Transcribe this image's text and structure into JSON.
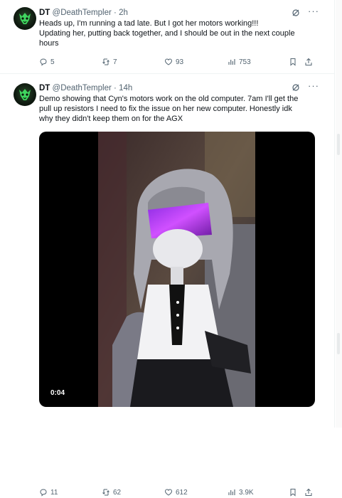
{
  "colors": {
    "accent": "#1d9bf0",
    "text": "#0f1419",
    "muted": "#536471",
    "visor": "#b030ff"
  },
  "tweets": [
    {
      "name": "DT",
      "handle": "@DeathTempler",
      "separator": "·",
      "time": "2h",
      "lines": [
        "Heads up, I'm running a tad late. But I got her motors working!!!",
        "Updating her, putting back together, and I should be out in the next couple",
        "hours"
      ],
      "replies": "5",
      "reposts": "7",
      "likes": "93",
      "views": "753"
    },
    {
      "name": "DT",
      "handle": "@DeathTempler",
      "separator": "·",
      "time": "14h",
      "lines": [
        "Demo showing that Cyn's motors work on the old computer. 7am I'll get the",
        "pull up resistors I need to fix the issue on her new computer. Honestly idk",
        "why they didn't keep them on for the AGX"
      ],
      "video_time": "0:04",
      "replies": "11",
      "reposts": "62",
      "likes": "612",
      "views": "3.9K"
    }
  ],
  "icons": {
    "reply": "reply-icon",
    "repost": "repost-icon",
    "like": "heart-icon",
    "views": "views-icon",
    "bookmark": "bookmark-icon",
    "share": "share-icon",
    "grok": "grok-icon",
    "more": "more-icon"
  }
}
